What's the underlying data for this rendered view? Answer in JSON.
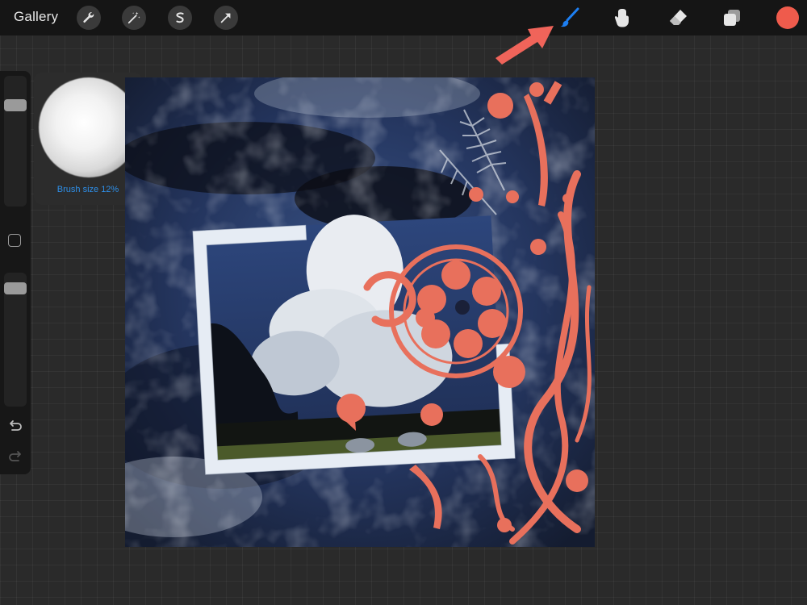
{
  "toolbar": {
    "gallery_label": "Gallery",
    "left_tools": [
      {
        "name": "wrench-icon"
      },
      {
        "name": "magic-wand-icon"
      },
      {
        "name": "selection-icon"
      },
      {
        "name": "transform-arrow-icon"
      }
    ],
    "right_tools": [
      {
        "name": "paintbrush-icon",
        "active": true
      },
      {
        "name": "smudge-icon"
      },
      {
        "name": "eraser-icon"
      },
      {
        "name": "layers-icon"
      }
    ],
    "active_color": "#ef5b4c",
    "active_tool_color": "#1d7ff2"
  },
  "brush_preview": {
    "size_label": "Brush size 12%"
  },
  "sidebar": {
    "brush_size_level": 0.2,
    "opacity_level": 0.08
  },
  "annotation": {
    "arrow_color": "#f0645a"
  },
  "colors": {
    "canvas_blue": "#2c4474",
    "accent_coral": "#e8705c",
    "frame_white": "#e6ecf4"
  }
}
